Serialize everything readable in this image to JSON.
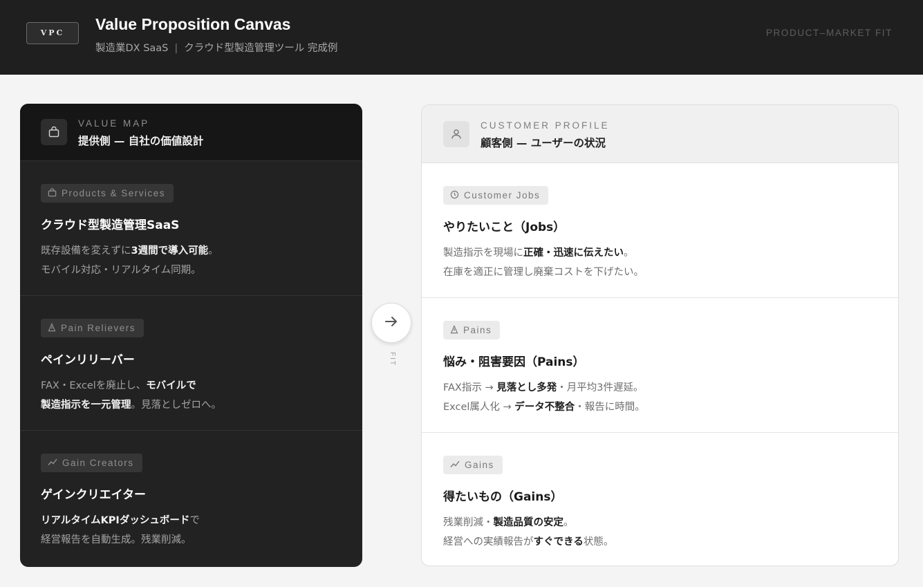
{
  "header": {
    "logo": "VPC",
    "title": "Value Proposition Canvas",
    "subtitle_left": "製造業DX SaaS",
    "subtitle_sep": "|",
    "subtitle_right": "クラウド型製造管理ツール 完成例",
    "right_label": "PRODUCT–MARKET FIT"
  },
  "value_map": {
    "eyebrow": "VALUE MAP",
    "title": "提供側 — 自社の価値設計",
    "icon": "bag-icon",
    "sections": [
      {
        "chip": "Products & Services",
        "icon": "bag-icon",
        "title": "クラウド型製造管理SaaS",
        "line1": [
          "既存設備を変えずに",
          "3週間で導入可能",
          "。"
        ],
        "line2": [
          "モバイル対応・リアルタイム同期。"
        ]
      },
      {
        "chip": "Pain Relievers",
        "icon": "warning-icon",
        "title": "ペインリリーバー",
        "line1": [
          "FAX・Excelを廃止し、",
          "モバイルで"
        ],
        "line2": [
          "製造指示を一元管理",
          "。見落としゼロへ。"
        ]
      },
      {
        "chip": "Gain Creators",
        "icon": "trend-icon",
        "title": "ゲインクリエイター",
        "line1": [
          "リアルタイムKPIダッシュボード",
          "で"
        ],
        "line2": [
          "経営報告を自動生成。残業削減。"
        ]
      }
    ]
  },
  "fit": {
    "icon": "arrow-right-icon",
    "label": "FIT"
  },
  "customer_profile": {
    "eyebrow": "CUSTOMER PROFILE",
    "title": "顧客側 — ユーザーの状況",
    "icon": "user-icon",
    "sections": [
      {
        "chip": "Customer Jobs",
        "icon": "clock-icon",
        "title": "やりたいこと（Jobs）",
        "line1": [
          "製造指示を現場に",
          "正確・迅速に伝えたい",
          "。"
        ],
        "line2": [
          "在庫を適正に管理し廃棄コストを下げたい。"
        ]
      },
      {
        "chip": "Pains",
        "icon": "warning-icon",
        "title": "悩み・阻害要因（Pains）",
        "line1": [
          "FAX指示 → ",
          "見落とし多発",
          "・月平均3件遅延。"
        ],
        "line2": [
          "Excel属人化 → ",
          "データ不整合",
          "・報告に時間。"
        ]
      },
      {
        "chip": "Gains",
        "icon": "trend-icon",
        "title": "得たいもの（Gains）",
        "line1": [
          "残業削減・",
          "製造品質の安定",
          "。"
        ],
        "line2": [
          "経営への実績報告が",
          "すぐできる",
          "状態。"
        ]
      }
    ]
  }
}
